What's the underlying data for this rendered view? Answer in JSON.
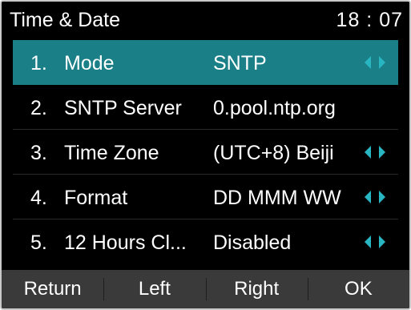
{
  "header": {
    "title": "Time & Date",
    "clock": "18 : 07"
  },
  "colors": {
    "accent": "#29b6c3",
    "selected_row": "#1a7f87",
    "softkey_bar": "#3a3a3a"
  },
  "items": [
    {
      "num": "1.",
      "label": "Mode",
      "value": "SNTP",
      "arrows": true
    },
    {
      "num": "2.",
      "label": "SNTP Server",
      "value": "0.pool.ntp.org",
      "arrows": false
    },
    {
      "num": "3.",
      "label": "Time Zone",
      "value": "(UTC+8) Beiji",
      "arrows": true
    },
    {
      "num": "4.",
      "label": "Format",
      "value": "DD MMM WW",
      "arrows": true
    },
    {
      "num": "5.",
      "label": "12 Hours Cl...",
      "value": "Disabled",
      "arrows": true
    }
  ],
  "softkeys": {
    "return": "Return",
    "left": "Left",
    "right": "Right",
    "ok": "OK"
  }
}
